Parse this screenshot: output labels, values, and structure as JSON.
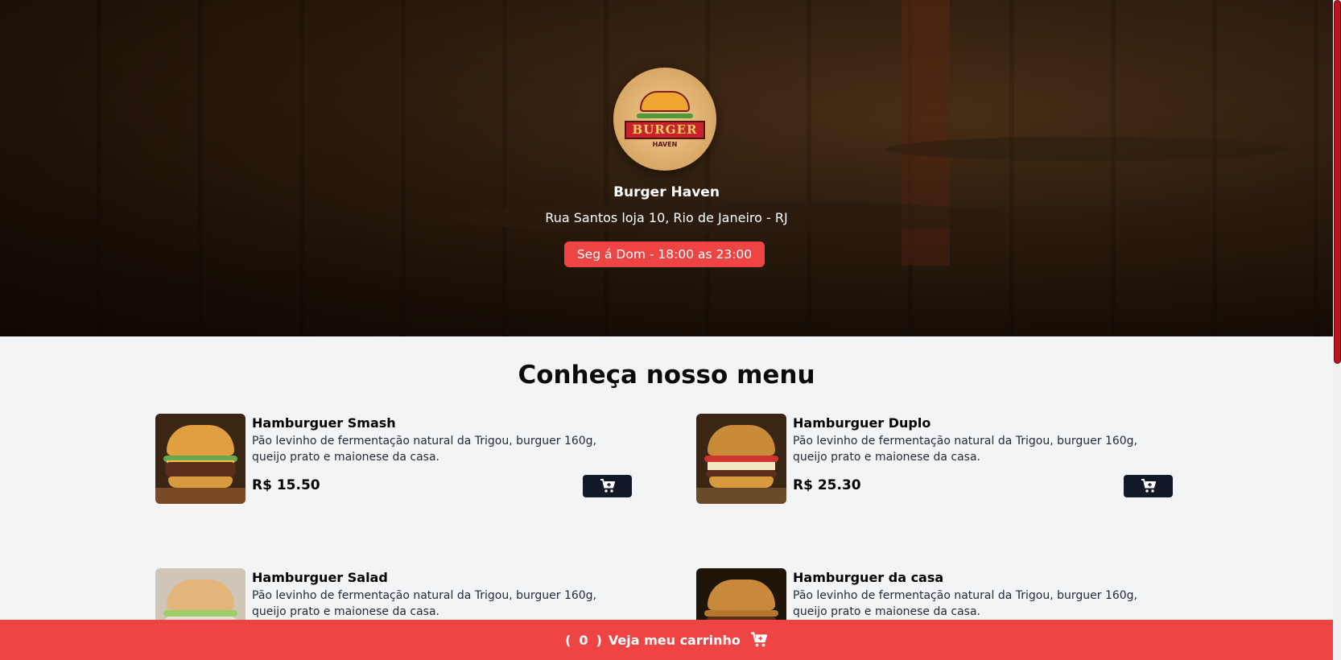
{
  "header": {
    "restaurant_name": "Burger Haven",
    "address": "Rua Santos loja 10, Rio de Janeiro - RJ",
    "hours": "Seg á Dom - 18:00 as 23:00",
    "logo": {
      "text": "BURGER",
      "subtext": "HAVEN"
    }
  },
  "menu": {
    "title": "Conheça nosso menu",
    "items": [
      {
        "name": "Hamburguer Smash",
        "description": "Pão levinho de fermentação natural da Trigou, burguer 160g, queijo prato e maionese da casa.",
        "price": "R$ 15.50"
      },
      {
        "name": "Hamburguer Duplo",
        "description": "Pão levinho de fermentação natural da Trigou, burguer 160g, queijo prato e maionese da casa.",
        "price": "R$ 25.30"
      },
      {
        "name": "Hamburguer Salad",
        "description": "Pão levinho de fermentação natural da Trigou, burguer 160g, queijo prato e maionese da casa."
      },
      {
        "name": "Hamburguer da casa",
        "description": "Pão levinho de fermentação natural da Trigou, burguer 160g, queijo prato e maionese da casa."
      }
    ],
    "add_button_icon": "cart-plus-icon"
  },
  "cart": {
    "open_paren": "(",
    "count": "0",
    "close_paren": ")",
    "label": "Veja meu carrinho",
    "icon": "cart-icon"
  },
  "colors": {
    "accent": "#ef4444",
    "button_dark": "#111827",
    "page_bg": "#f3f4f6"
  }
}
